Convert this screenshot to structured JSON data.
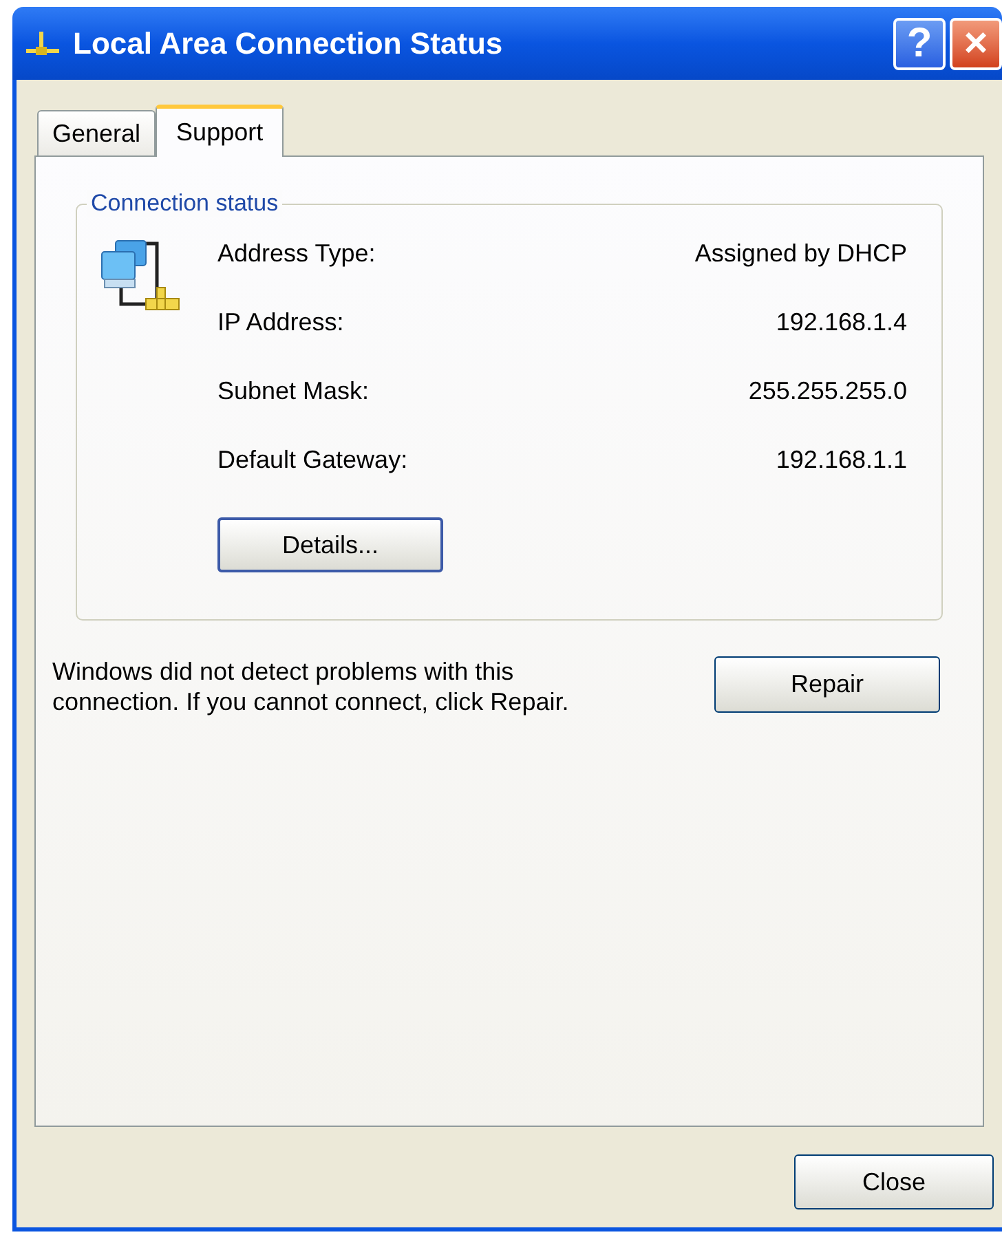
{
  "window": {
    "title": "Local Area Connection Status"
  },
  "title_buttons": [
    {
      "kind": "help",
      "label": "?"
    },
    {
      "kind": "close",
      "label": "×"
    }
  ],
  "tabs": [
    {
      "label": "General",
      "selected": false
    },
    {
      "label": "Support",
      "selected": true
    }
  ],
  "connection_status": {
    "legend": "Connection status",
    "rows": [
      {
        "label": "Address Type:",
        "value": "Assigned by DHCP"
      },
      {
        "label": "IP Address:",
        "value": "192.168.1.4"
      },
      {
        "label": "Subnet Mask:",
        "value": "255.255.255.0"
      },
      {
        "label": "Default Gateway:",
        "value": "192.168.1.1"
      }
    ],
    "details_button": "Details..."
  },
  "message": "Windows did not detect problems with this connection. If you cannot connect, click Repair.",
  "repair_button": "Repair",
  "close_button": "Close"
}
